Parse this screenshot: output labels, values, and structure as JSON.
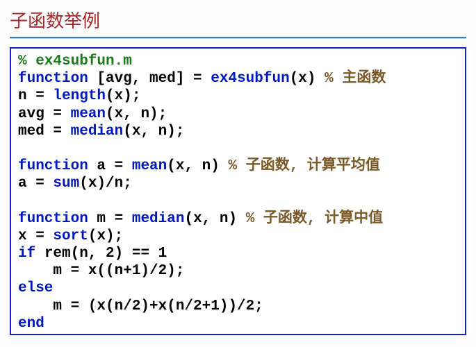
{
  "title": "子函数举例",
  "code": {
    "line1_comment": "% ex4subfun.m",
    "line2_kw": "function",
    "line2_rest": " [avg, med] = ",
    "line2_name": "ex4subfun",
    "line2_arg": "(x) ",
    "line2_cmt": "% 主函数",
    "line3_a": "n = ",
    "line3_fn": "length",
    "line3_b": "(x);",
    "line4_a": "avg = ",
    "line4_fn": "mean",
    "line4_b": "(x, n);",
    "line5_a": "med = ",
    "line5_fn": "median",
    "line5_b": "(x, n);",
    "line7_kw": "function",
    "line7_rest": " a = ",
    "line7_name": "mean",
    "line7_arg": "(x, n) ",
    "line7_cmt": "% 子函数, 计算平均值",
    "line8_a": "a = ",
    "line8_fn": "sum",
    "line8_b": "(x)/n;",
    "line10_kw": "function",
    "line10_rest": " m = ",
    "line10_name": "median",
    "line10_arg": "(x, n) ",
    "line10_cmt": "% 子函数, 计算中值",
    "line11_a": "x = ",
    "line11_fn": "sort",
    "line11_b": "(x);",
    "line12_kw": "if",
    "line12_rest": " rem(n, 2) == 1",
    "line13": "    m = x((n+1)/2);",
    "line14_kw": "else",
    "line15": "    m = (x(n/2)+x(n/2+1))/2;",
    "line16_kw": "end"
  }
}
